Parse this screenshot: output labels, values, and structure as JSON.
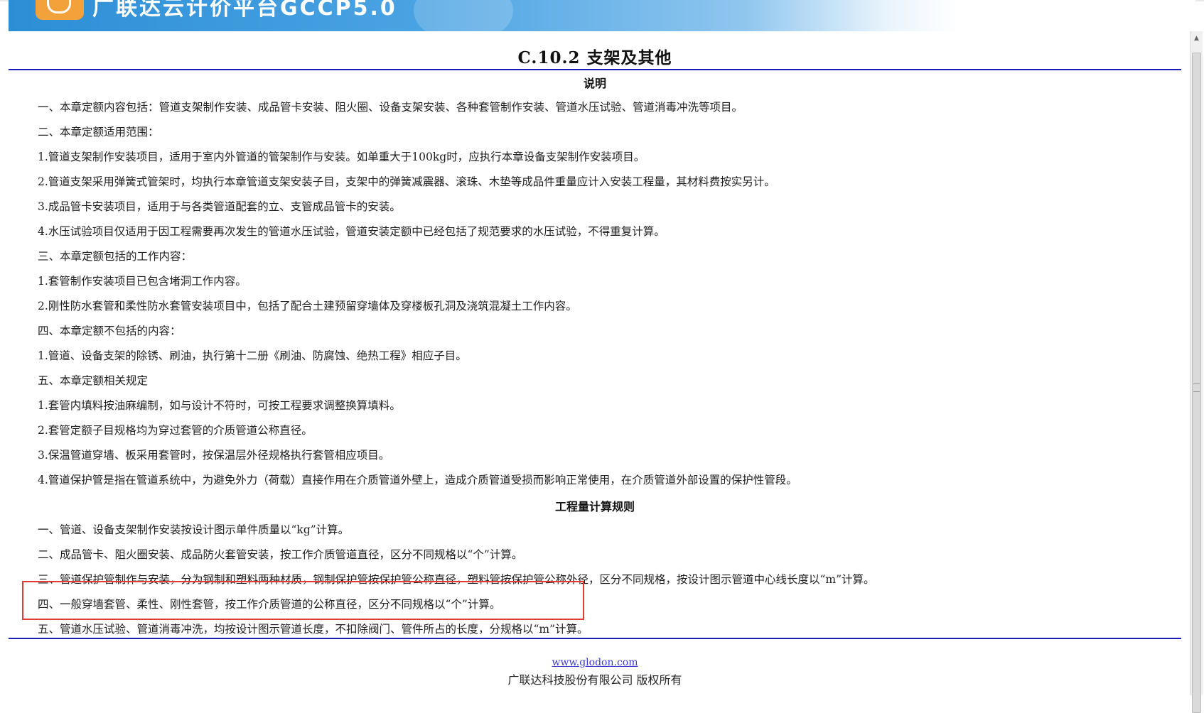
{
  "banner": {
    "title": "广联达云计价平台GCCP5.0",
    "logo_icon": "glodon-logo-icon",
    "colors": {
      "banner_blue": "#2d8ed6",
      "logo_orange": "#f3a13a"
    }
  },
  "doc": {
    "title": "C.10.2 支架及其他",
    "section1_heading": "说明",
    "section1_lines": [
      "一、本章定额内容包括：管道支架制作安装、成品管卡安装、阻火圈、设备支架安装、各种套管制作安装、管道水压试验、管道消毒冲洗等项目。",
      "二、本章定额适用范围：",
      "1.管道支架制作安装项目，适用于室内外管道的管架制作与安装。如单重大于100kg时，应执行本章设备支架制作安装项目。",
      "2.管道支架采用弹簧式管架时，均执行本章管道支架安装子目，支架中的弹簧减震器、滚珠、木垫等成品件重量应计入安装工程量，其材料费按实另计。",
      "3.成品管卡安装项目，适用于与各类管道配套的立、支管成品管卡的安装。",
      "4.水压试验项目仅适用于因工程需要再次发生的管道水压试验，管道安装定额中已经包括了规范要求的水压试验，不得重复计算。",
      "三、本章定额包括的工作内容：",
      "1.套管制作安装项目已包含堵洞工作内容。",
      "2.刚性防水套管和柔性防水套管安装项目中，包括了配合土建预留穿墙体及穿楼板孔洞及浇筑混凝土工作内容。",
      "四、本章定额不包括的内容：",
      "1.管道、设备支架的除锈、刷油，执行第十二册《刷油、防腐蚀、绝热工程》相应子目。",
      "五、本章定额相关规定",
      "1.套管内填料按油麻编制，如与设计不符时，可按工程要求调整换算填料。",
      "2.套管定额子目规格均为穿过套管的介质管道公称直径。",
      "3.保温管道穿墙、板采用套管时，按保温层外径规格执行套管相应项目。",
      "4.管道保护管是指在管道系统中，为避免外力（荷载）直接作用在介质管道外壁上，造成介质管道受损而影响正常使用，在介质管道外部设置的保护性管段。"
    ],
    "section2_heading": "工程量计算规则",
    "section2_lines": [
      "一、管道、设备支架制作安装按设计图示单件质量以“kg”计算。",
      "二、成品管卡、阻火圈安装、成品防火套管安装，按工作介质管道直径，区分不同规格以“个”计算。",
      "三、管道保护管制作与安装，分为钢制和塑料两种材质，钢制保护管按保护管公称直径，塑料管按保护管公称外径，区分不同规格，按设计图示管道中心线长度以“m”计算。",
      "四、一般穿墙套管、柔性、刚性套管，按工作介质管道的公称直径，区分不同规格以“个”计算。",
      "五、管道水压试验、管道消毒冲洗，均按设计图示管道长度，不扣除阀门、管件所占的长度，分规格以“m”计算。"
    ],
    "highlight_color": "#e53935",
    "rule_color": "#1a1ab8"
  },
  "footer": {
    "link": "www.glodon.com",
    "copyright": "广联达科技股份有限公司 版权所有"
  }
}
